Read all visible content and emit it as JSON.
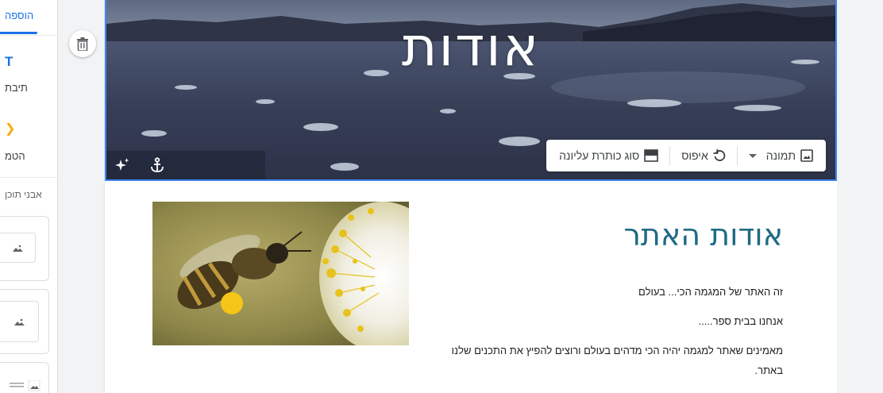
{
  "left_panel": {
    "tab_label": "הוספה",
    "text_box_label": "תיבת",
    "embed_label": "הטמ",
    "content_blocks_label": "אבני תוכן"
  },
  "header": {
    "title": "אודות",
    "toolbar": {
      "image_label": "תמונה",
      "reset_label": "איפוס",
      "header_type_label": "סוג כותרת עליונה"
    }
  },
  "content": {
    "title": "אודות האתר",
    "paragraphs": [
      "זה האתר של המגמה הכי... בעולם",
      "אנחנו בבית ספר.....",
      "מאמינים שאתר למגמה יהיה הכי מדהים בעולם ורוצים להפיץ את התכנים שלנו",
      "באתר."
    ]
  },
  "colors": {
    "accent": "#1a73e8",
    "selection_border": "#4285f4",
    "title_color": "#1f6a86"
  }
}
